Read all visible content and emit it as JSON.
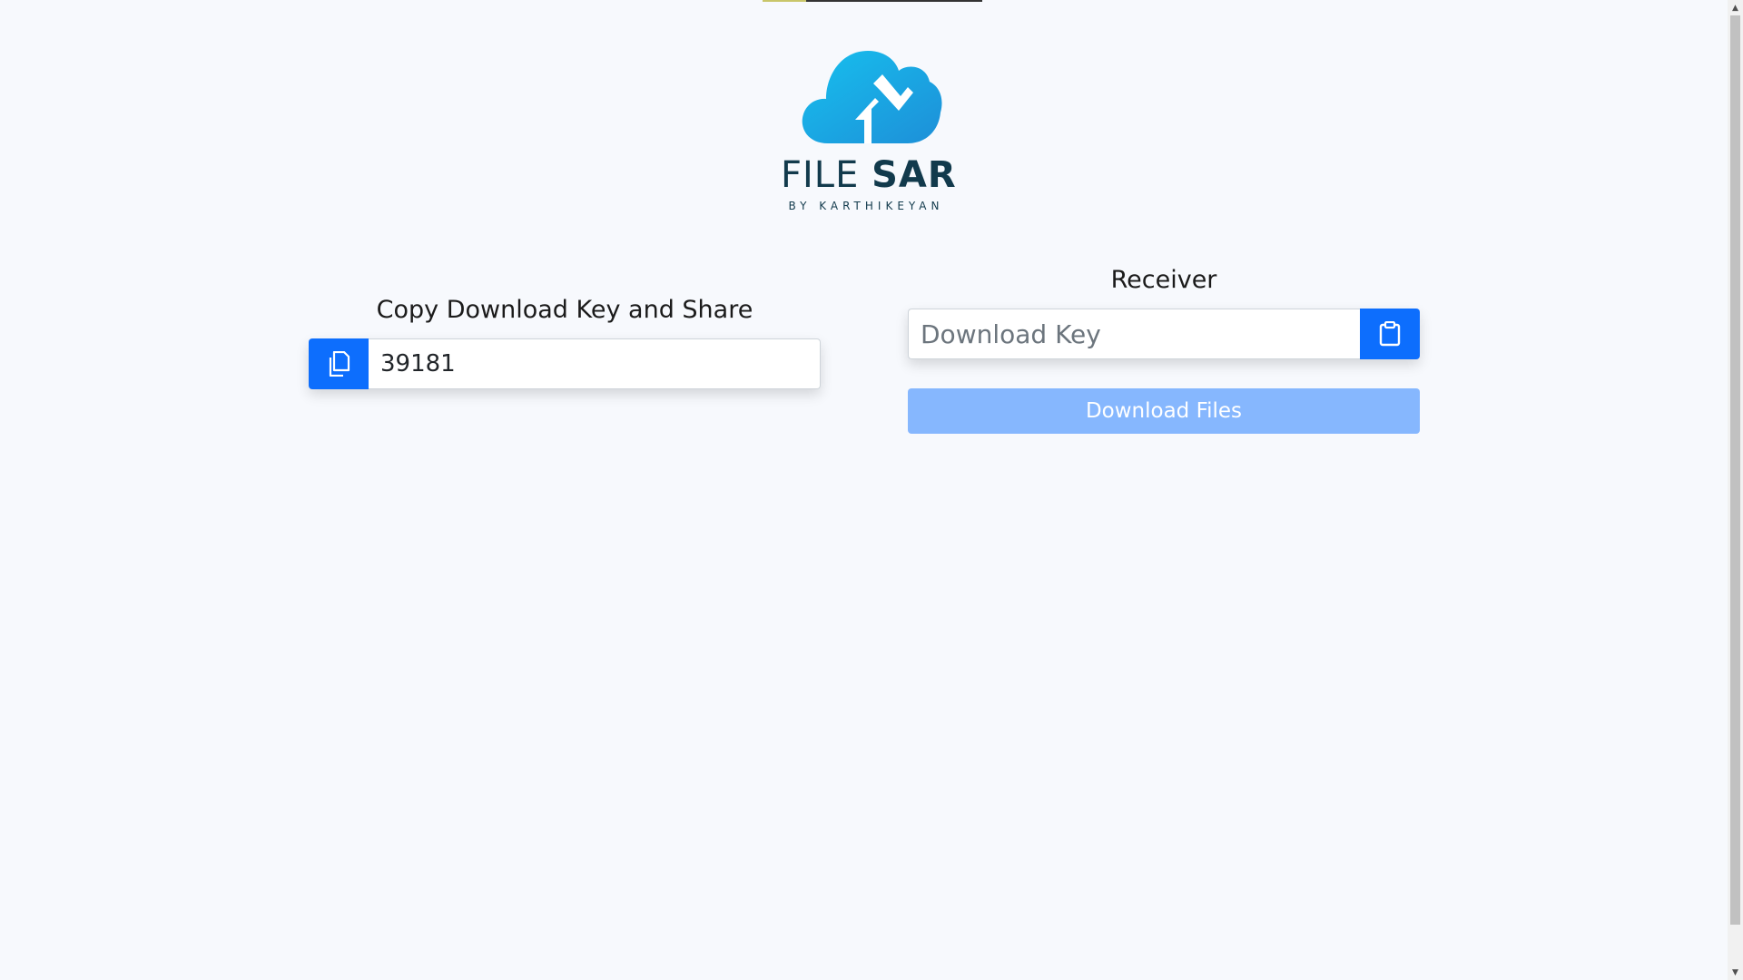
{
  "logo": {
    "word_light": "FILE",
    "word_bold": "SAR",
    "subtitle": "BY KARTHIKEYAN",
    "icon": "cloud-transfer-icon"
  },
  "sender": {
    "title": "Copy Download Key and Share",
    "download_key": "39181",
    "copy_icon": "copy-icon"
  },
  "receiver": {
    "title": "Receiver",
    "input_placeholder": "Download Key",
    "input_value": "",
    "paste_icon": "clipboard-icon",
    "download_button_label": "Download Files"
  },
  "colors": {
    "primary": "#0d6efd",
    "primary_disabled": "#86b7fe",
    "logo_dark": "#123a4c",
    "logo_cloud": "#1aa9e6"
  }
}
